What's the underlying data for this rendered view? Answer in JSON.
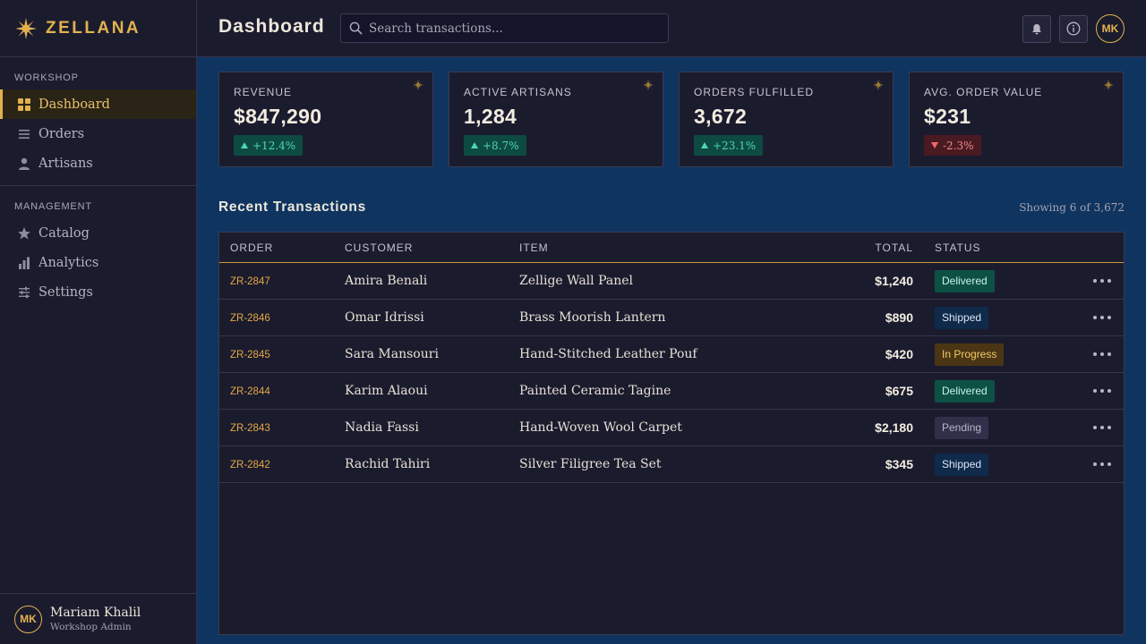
{
  "brand": {
    "name": "ZELLANA"
  },
  "nav": {
    "sections": [
      {
        "heading": "WORKSHOP",
        "items": [
          {
            "label": "Dashboard",
            "icon": "grid-icon",
            "active": true
          },
          {
            "label": "Orders",
            "icon": "list-icon",
            "active": false
          },
          {
            "label": "Artisans",
            "icon": "person-icon",
            "active": false
          }
        ]
      },
      {
        "heading": "MANAGEMENT",
        "items": [
          {
            "label": "Catalog",
            "icon": "star-icon",
            "active": false
          },
          {
            "label": "Analytics",
            "icon": "bar-chart-icon",
            "active": false
          },
          {
            "label": "Settings",
            "icon": "sliders-icon",
            "active": false
          }
        ]
      }
    ]
  },
  "user": {
    "initials": "MK",
    "name": "Mariam Khalil",
    "role": "Workshop Admin"
  },
  "header": {
    "title": "Dashboard",
    "search_placeholder": "Search transactions...",
    "avatar_initials": "MK"
  },
  "stats": [
    {
      "label": "REVENUE",
      "value": "$847,290",
      "delta": "+12.4%",
      "direction": "up"
    },
    {
      "label": "ACTIVE ARTISANS",
      "value": "1,284",
      "delta": "+8.7%",
      "direction": "up"
    },
    {
      "label": "ORDERS FULFILLED",
      "value": "3,672",
      "delta": "+23.1%",
      "direction": "up"
    },
    {
      "label": "AVG. ORDER VALUE",
      "value": "$231",
      "delta": "-2.3%",
      "direction": "down"
    }
  ],
  "transactions": {
    "title": "Recent Transactions",
    "meta": "Showing 6 of 3,672",
    "columns": [
      "ORDER",
      "CUSTOMER",
      "ITEM",
      "TOTAL",
      "STATUS"
    ],
    "rows": [
      {
        "order": "ZR-2847",
        "customer": "Amira Benali",
        "item": "Zellige Wall Panel",
        "total": "$1,240",
        "status": "Delivered"
      },
      {
        "order": "ZR-2846",
        "customer": "Omar Idrissi",
        "item": "Brass Moorish Lantern",
        "total": "$890",
        "status": "Shipped"
      },
      {
        "order": "ZR-2845",
        "customer": "Sara Mansouri",
        "item": "Hand-Stitched Leather Pouf",
        "total": "$420",
        "status": "In Progress"
      },
      {
        "order": "ZR-2844",
        "customer": "Karim Alaoui",
        "item": "Painted Ceramic Tagine",
        "total": "$675",
        "status": "Delivered"
      },
      {
        "order": "ZR-2843",
        "customer": "Nadia Fassi",
        "item": "Hand-Woven Wool Carpet",
        "total": "$2,180",
        "status": "Pending"
      },
      {
        "order": "ZR-2842",
        "customer": "Rachid Tahiri",
        "item": "Silver Filigree Tea Set",
        "total": "$345",
        "status": "Shipped"
      }
    ]
  },
  "colors": {
    "accent": "#e2b24e",
    "panel": "#1b1b2e",
    "main_bg": "#0f3460",
    "positive": "#4fd8b0",
    "negative": "#ee6b6b"
  }
}
